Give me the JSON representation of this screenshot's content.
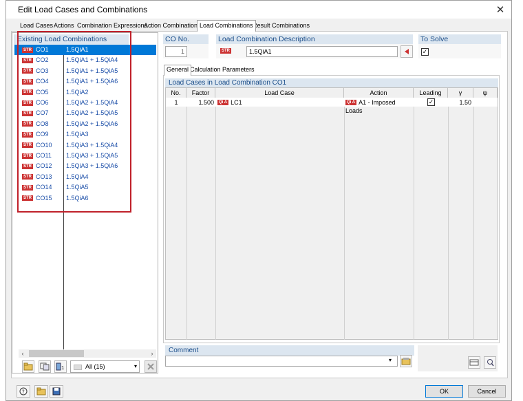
{
  "window": {
    "title": "Edit Load Cases and Combinations"
  },
  "tabs": [
    {
      "label": "Load Cases"
    },
    {
      "label": "Actions"
    },
    {
      "label": "Combination Expressions"
    },
    {
      "label": "Action Combinations"
    },
    {
      "label": "Load Combinations"
    },
    {
      "label": "Result Combinations"
    }
  ],
  "left_panel": {
    "header": "Existing Load Combinations",
    "items": [
      {
        "badge": "STR",
        "id": "CO1",
        "description": "1.5QiA1"
      },
      {
        "badge": "STR",
        "id": "CO2",
        "description": "1.5QiA1 + 1.5QiA4"
      },
      {
        "badge": "STR",
        "id": "CO3",
        "description": "1.5QiA1 + 1.5QiA5"
      },
      {
        "badge": "STR",
        "id": "CO4",
        "description": "1.5QiA1 + 1.5QiA6"
      },
      {
        "badge": "STR",
        "id": "CO5",
        "description": "1.5QiA2"
      },
      {
        "badge": "STR",
        "id": "CO6",
        "description": "1.5QiA2 + 1.5QiA4"
      },
      {
        "badge": "STR",
        "id": "CO7",
        "description": "1.5QiA2 + 1.5QiA5"
      },
      {
        "badge": "STR",
        "id": "CO8",
        "description": "1.5QiA2 + 1.5QiA6"
      },
      {
        "badge": "STR",
        "id": "CO9",
        "description": "1.5QiA3"
      },
      {
        "badge": "STR",
        "id": "CO10",
        "description": "1.5QiA3 + 1.5QiA4"
      },
      {
        "badge": "STR",
        "id": "CO11",
        "description": "1.5QiA3 + 1.5QiA5"
      },
      {
        "badge": "STR",
        "id": "CO12",
        "description": "1.5QiA3 + 1.5QiA6"
      },
      {
        "badge": "STR",
        "id": "CO13",
        "description": "1.5QiA4"
      },
      {
        "badge": "STR",
        "id": "CO14",
        "description": "1.5QiA5"
      },
      {
        "badge": "STR",
        "id": "CO15",
        "description": "1.5QiA6"
      }
    ],
    "selected_index": 0,
    "filter_value": "All (15)"
  },
  "co_no": {
    "label": "CO No.",
    "value": "1"
  },
  "description": {
    "label": "Load Combination Description",
    "badge": "STR",
    "value": "1.5QiA1"
  },
  "to_solve": {
    "label": "To Solve",
    "checked": true
  },
  "subtabs": [
    {
      "label": "General"
    },
    {
      "label": "Calculation Parameters"
    }
  ],
  "table": {
    "title": "Load Cases in Load Combination CO1",
    "headers": [
      "No.",
      "Factor",
      "Load Case",
      "Action",
      "Leading",
      "γ",
      "ψ"
    ],
    "rows": [
      {
        "no": "1",
        "factor": "1.500",
        "lc_badge": "Qi A",
        "load_case": "LC1",
        "action_badge": "Qi A",
        "action": "A1 - Imposed Loads",
        "leading": true,
        "gamma": "1.50",
        "psi": ""
      }
    ]
  },
  "comment": {
    "label": "Comment",
    "value": ""
  },
  "buttons": {
    "ok": "OK",
    "cancel": "Cancel"
  },
  "colors": {
    "accent": "#0078d7",
    "badge": "#cc3333",
    "header_bg": "#dce6f0",
    "header_text": "#1b4e8a",
    "highlight_frame": "#c0202a"
  }
}
